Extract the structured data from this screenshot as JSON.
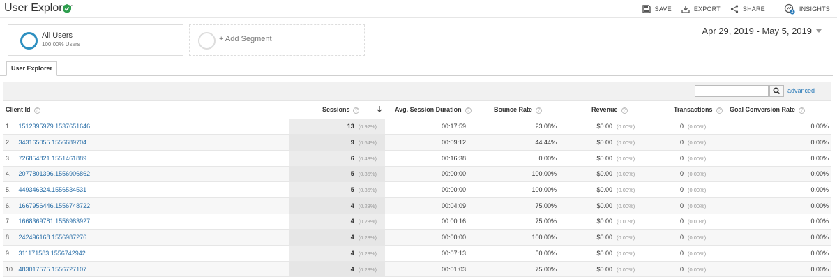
{
  "header": {
    "title": "User Explorer",
    "actions": {
      "save": "SAVE",
      "export": "EXPORT",
      "share": "SHARE",
      "insights": "INSIGHTS"
    },
    "insights_badge": "4"
  },
  "segments": {
    "active": {
      "name": "All Users",
      "subtitle": "100.00% Users"
    },
    "add_label": "+ Add Segment"
  },
  "date_range": "Apr 29, 2019 - May 5, 2019",
  "tabs": [
    "User Explorer"
  ],
  "search": {
    "placeholder": "",
    "advanced_label": "advanced"
  },
  "table": {
    "columns": [
      "Client Id",
      "Sessions",
      "Avg. Session Duration",
      "Bounce Rate",
      "Revenue",
      "Transactions",
      "Goal Conversion Rate"
    ],
    "rows": [
      {
        "index": "1.",
        "client_id": "1512395979.1537651646",
        "sessions": "13",
        "sessions_pct": "(0.92%)",
        "duration": "00:17:59",
        "bounce": "23.08%",
        "revenue": "$0.00",
        "revenue_pct": "(0.00%)",
        "transactions": "0",
        "transactions_pct": "(0.00%)",
        "goal": "0.00%"
      },
      {
        "index": "2.",
        "client_id": "343165055.1556689704",
        "sessions": "9",
        "sessions_pct": "(0.64%)",
        "duration": "00:09:12",
        "bounce": "44.44%",
        "revenue": "$0.00",
        "revenue_pct": "(0.00%)",
        "transactions": "0",
        "transactions_pct": "(0.00%)",
        "goal": "0.00%"
      },
      {
        "index": "3.",
        "client_id": "726854821.1551461889",
        "sessions": "6",
        "sessions_pct": "(0.43%)",
        "duration": "00:16:38",
        "bounce": "0.00%",
        "revenue": "$0.00",
        "revenue_pct": "(0.00%)",
        "transactions": "0",
        "transactions_pct": "(0.00%)",
        "goal": "0.00%"
      },
      {
        "index": "4.",
        "client_id": "2077801396.1556906862",
        "sessions": "5",
        "sessions_pct": "(0.35%)",
        "duration": "00:00:00",
        "bounce": "100.00%",
        "revenue": "$0.00",
        "revenue_pct": "(0.00%)",
        "transactions": "0",
        "transactions_pct": "(0.00%)",
        "goal": "0.00%"
      },
      {
        "index": "5.",
        "client_id": "449346324.1556534531",
        "sessions": "5",
        "sessions_pct": "(0.35%)",
        "duration": "00:00:00",
        "bounce": "100.00%",
        "revenue": "$0.00",
        "revenue_pct": "(0.00%)",
        "transactions": "0",
        "transactions_pct": "(0.00%)",
        "goal": "0.00%"
      },
      {
        "index": "6.",
        "client_id": "1667956446.1556748722",
        "sessions": "4",
        "sessions_pct": "(0.28%)",
        "duration": "00:04:09",
        "bounce": "75.00%",
        "revenue": "$0.00",
        "revenue_pct": "(0.00%)",
        "transactions": "0",
        "transactions_pct": "(0.00%)",
        "goal": "0.00%"
      },
      {
        "index": "7.",
        "client_id": "1668369781.1556983927",
        "sessions": "4",
        "sessions_pct": "(0.28%)",
        "duration": "00:00:16",
        "bounce": "75.00%",
        "revenue": "$0.00",
        "revenue_pct": "(0.00%)",
        "transactions": "0",
        "transactions_pct": "(0.00%)",
        "goal": "0.00%"
      },
      {
        "index": "8.",
        "client_id": "242496168.1556987276",
        "sessions": "4",
        "sessions_pct": "(0.28%)",
        "duration": "00:00:00",
        "bounce": "100.00%",
        "revenue": "$0.00",
        "revenue_pct": "(0.00%)",
        "transactions": "0",
        "transactions_pct": "(0.00%)",
        "goal": "0.00%"
      },
      {
        "index": "9.",
        "client_id": "311171583.1556742942",
        "sessions": "4",
        "sessions_pct": "(0.28%)",
        "duration": "00:07:13",
        "bounce": "50.00%",
        "revenue": "$0.00",
        "revenue_pct": "(0.00%)",
        "transactions": "0",
        "transactions_pct": "(0.00%)",
        "goal": "0.00%"
      },
      {
        "index": "10.",
        "client_id": "483017575.1556727107",
        "sessions": "4",
        "sessions_pct": "(0.28%)",
        "duration": "00:01:03",
        "bounce": "75.00%",
        "revenue": "$0.00",
        "revenue_pct": "(0.00%)",
        "transactions": "0",
        "transactions_pct": "(0.00%)",
        "goal": "0.00%"
      }
    ]
  },
  "icons": {
    "verified": "verified-shield-icon",
    "save": "floppy-disk-icon",
    "export": "download-icon",
    "share": "share-icon",
    "insights": "insights-icon",
    "search": "magnifier-icon",
    "help": "question-mark-icon",
    "sort": "sort-down-arrow-icon"
  },
  "colors": {
    "accent": "#2d8fc0",
    "link": "#2a6fa8",
    "verified": "#2e9e4e",
    "sort_column_bg": "#ececec"
  }
}
